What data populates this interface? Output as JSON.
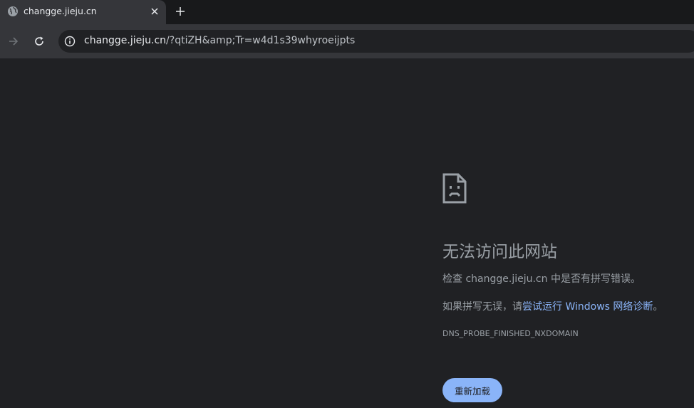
{
  "tab": {
    "title": "changge.jieju.cn",
    "icon": "globe-icon"
  },
  "toolbar": {
    "url_host": "changge.jieju.cn",
    "url_rest": "/?qtiZH&amp;Tr=w4d1s39whyroeijpts"
  },
  "error": {
    "heading": "无法访问此网站",
    "line1_prefix": "检查 ",
    "line1_host": "changge.jieju.cn",
    "line1_suffix": " 中是否有拼写错误。",
    "line2_prefix": "如果拼写无误，请",
    "line2_link": "尝试运行 Windows 网络诊断",
    "line2_suffix": "。",
    "code": "DNS_PROBE_FINISHED_NXDOMAIN",
    "reload_label": "重新加载"
  },
  "colors": {
    "accent": "#8ab4f8",
    "background": "#202124",
    "toolbar": "#35363a",
    "text_muted": "#9aa0a6"
  }
}
